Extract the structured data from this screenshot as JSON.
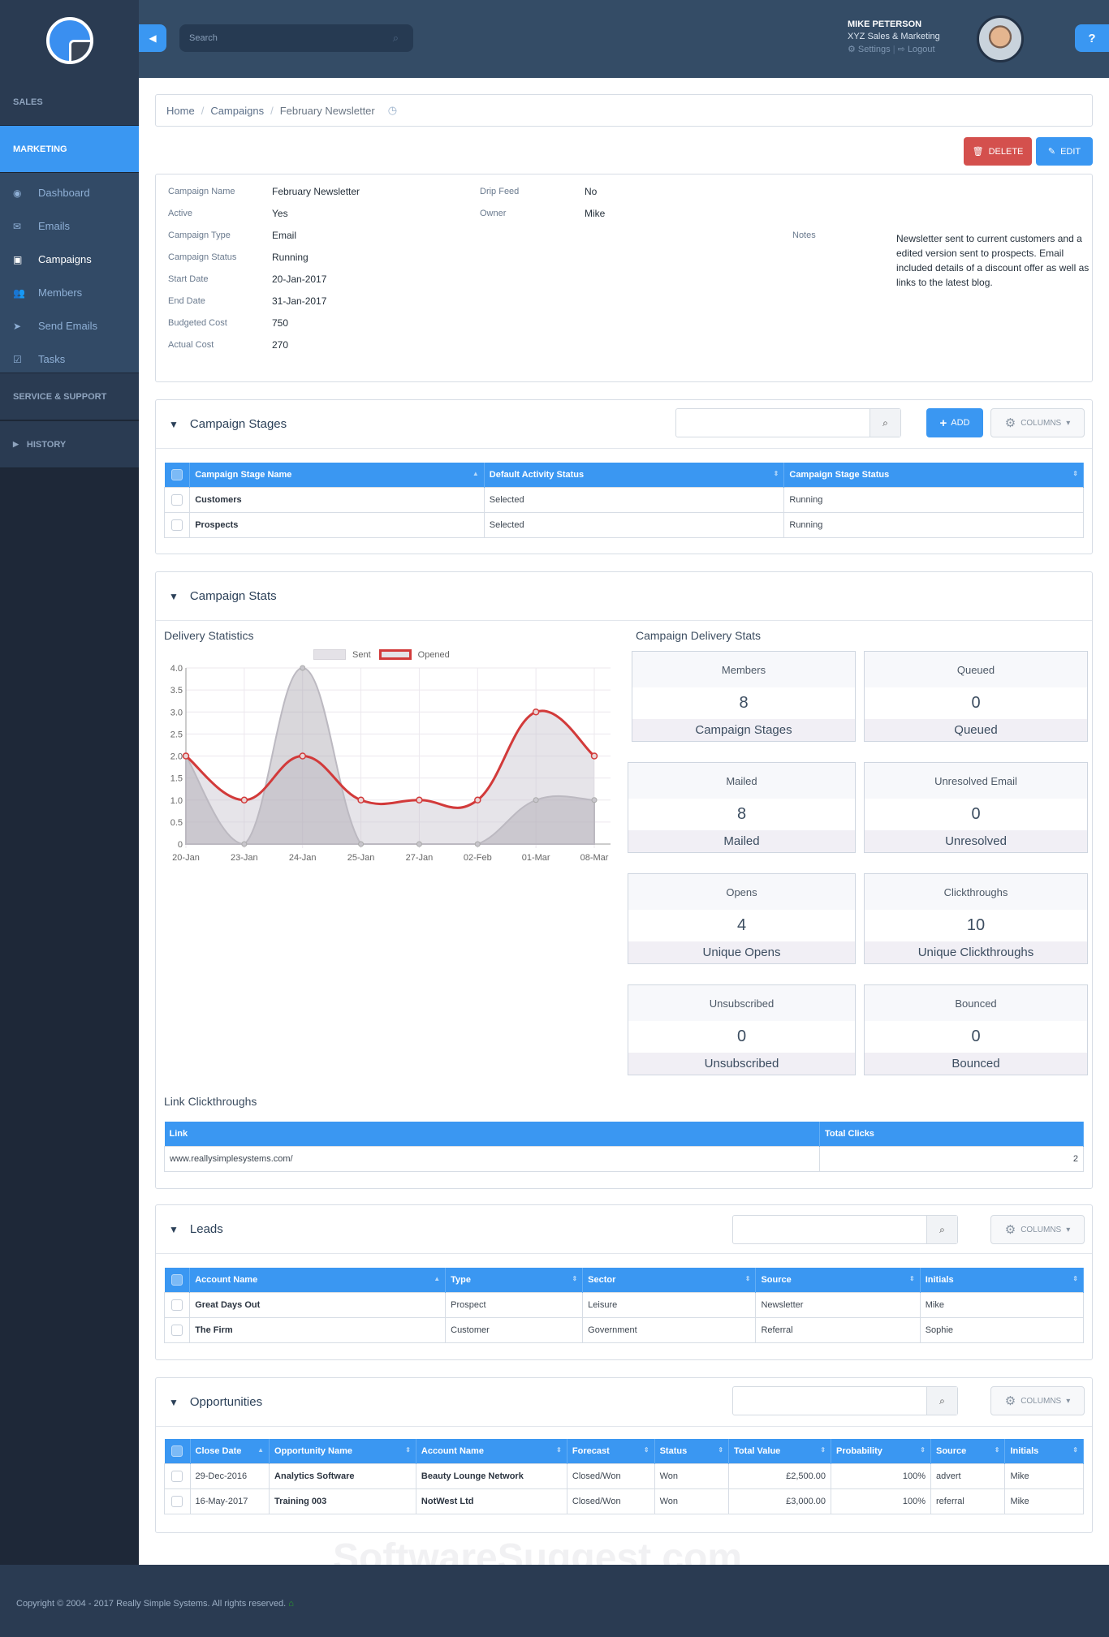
{
  "sidebar": {
    "sections": {
      "sales": "SALES",
      "marketing": "MARKETING",
      "service": "SERVICE & SUPPORT",
      "history": "HISTORY"
    },
    "items": [
      {
        "label": "Dashboard",
        "icon": "dashboard-icon"
      },
      {
        "label": "Emails",
        "icon": "envelope-icon"
      },
      {
        "label": "Campaigns",
        "icon": "inbox-icon",
        "active": true
      },
      {
        "label": "Members",
        "icon": "users-icon"
      },
      {
        "label": "Send Emails",
        "icon": "paper-plane-icon"
      },
      {
        "label": "Tasks",
        "icon": "checkbox-icon"
      }
    ]
  },
  "header": {
    "search_placeholder": "Search",
    "user_name": "MIKE PETERSON",
    "company": "XYZ Sales & Marketing",
    "settings_label": "Settings",
    "logout_label": "Logout",
    "help_label": "?"
  },
  "breadcrumb": {
    "home": "Home",
    "campaigns": "Campaigns",
    "current": "February Newsletter"
  },
  "actions": {
    "delete": "DELETE",
    "edit": "EDIT"
  },
  "details": {
    "left": [
      {
        "label": "Campaign Name",
        "value": "February Newsletter"
      },
      {
        "label": "Active",
        "value": "Yes"
      },
      {
        "label": "Campaign Type",
        "value": "Email"
      },
      {
        "label": "Campaign Status",
        "value": "Running"
      },
      {
        "label": "Start Date",
        "value": "20-Jan-2017"
      },
      {
        "label": "End Date",
        "value": "31-Jan-2017"
      },
      {
        "label": "Budgeted Cost",
        "value": "750"
      },
      {
        "label": "Actual Cost",
        "value": "270"
      }
    ],
    "right": [
      {
        "label": "Drip Feed",
        "value": "No"
      },
      {
        "label": "Owner",
        "value": "Mike"
      }
    ],
    "notes_label": "Notes",
    "notes": "Newsletter sent to current customers and a edited version sent to prospects. Email included details of a discount offer as well as links to the latest blog."
  },
  "stages": {
    "title": "Campaign Stages",
    "add_label": "ADD",
    "columns_label": "COLUMNS",
    "headers": [
      "Campaign Stage Name",
      "Default Activity Status",
      "Campaign Stage Status"
    ],
    "rows": [
      [
        "Customers",
        "Selected",
        "Running"
      ],
      [
        "Prospects",
        "Selected",
        "Running"
      ]
    ]
  },
  "stats": {
    "title": "Campaign Stats",
    "chart_title": "Delivery Statistics",
    "delivery_title": "Campaign Delivery Stats",
    "boxes": [
      {
        "header": "Members",
        "value": "8",
        "footer": "Campaign Stages"
      },
      {
        "header": "Queued",
        "value": "0",
        "footer": "Queued"
      },
      {
        "header": "Mailed",
        "value": "8",
        "footer": "Mailed"
      },
      {
        "header": "Unresolved Email",
        "value": "0",
        "footer": "Unresolved"
      },
      {
        "header": "Opens",
        "value": "4",
        "footer": "Unique Opens"
      },
      {
        "header": "Clickthroughs",
        "value": "10",
        "footer": "Unique Clickthroughs"
      },
      {
        "header": "Unsubscribed",
        "value": "0",
        "footer": "Unsubscribed"
      },
      {
        "header": "Bounced",
        "value": "0",
        "footer": "Bounced"
      }
    ],
    "links_title": "Link Clickthroughs",
    "links_headers": [
      "Link",
      "Total Clicks"
    ],
    "links_rows": [
      [
        "www.reallysimplesystems.com/",
        "2"
      ]
    ]
  },
  "chart_data": {
    "type": "line",
    "title": "Delivery Statistics",
    "categories": [
      "20-Jan",
      "23-Jan",
      "24-Jan",
      "25-Jan",
      "27-Jan",
      "02-Feb",
      "01-Mar",
      "08-Mar"
    ],
    "series": [
      {
        "name": "Sent",
        "values": [
          2,
          0,
          4,
          0,
          0,
          0,
          1,
          1
        ],
        "color": "#c8c6cc"
      },
      {
        "name": "Opened",
        "values": [
          2,
          1,
          2,
          1,
          1,
          1,
          3,
          2
        ],
        "color": "#d23a3a"
      }
    ],
    "yticks": [
      "0",
      "0.5",
      "1.0",
      "1.5",
      "2.0",
      "2.5",
      "3.0",
      "3.5",
      "4.0"
    ],
    "ylim": [
      0,
      4
    ],
    "legend": "top",
    "grid": true
  },
  "leads": {
    "title": "Leads",
    "columns_label": "COLUMNS",
    "headers": [
      "Account Name",
      "Type",
      "Sector",
      "Source",
      "Initials"
    ],
    "rows": [
      [
        "Great Days Out",
        "Prospect",
        "Leisure",
        "Newsletter",
        "Mike"
      ],
      [
        "The Firm",
        "Customer",
        "Government",
        "Referral",
        "Sophie"
      ]
    ]
  },
  "opportunities": {
    "title": "Opportunities",
    "columns_label": "COLUMNS",
    "headers": [
      "Close Date",
      "Opportunity Name",
      "Account Name",
      "Forecast",
      "Status",
      "Total Value",
      "Probability",
      "Source",
      "Initials"
    ],
    "rows": [
      [
        "29-Dec-2016",
        "Analytics Software",
        "Beauty Lounge Network",
        "Closed/Won",
        "Won",
        "£2,500.00",
        "100%",
        "advert",
        "Mike"
      ],
      [
        "16-May-2017",
        "Training 003",
        "NotWest Ltd",
        "Closed/Won",
        "Won",
        "£3,000.00",
        "100%",
        "referral",
        "Mike"
      ]
    ]
  },
  "footer": {
    "copyright": "Copyright © 2004 - 2017 Really Simple Systems. All rights reserved."
  },
  "watermark": "SoftwareSuggest.com"
}
